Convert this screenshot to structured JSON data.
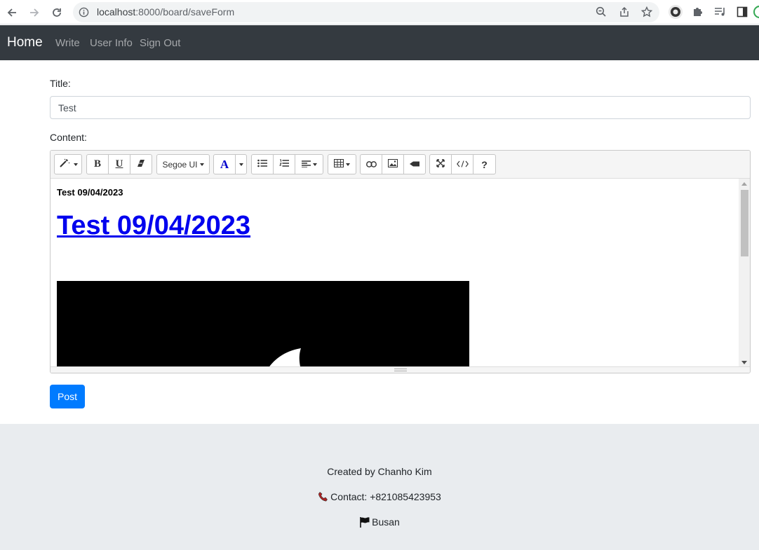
{
  "browser": {
    "url_host": "localhost",
    "url_path": ":8000/board/saveForm"
  },
  "navbar": {
    "brand": "Home",
    "links": [
      "Write",
      "User Info",
      "Sign Out"
    ]
  },
  "form": {
    "title_label": "Title:",
    "title_value": "Test",
    "content_label": "Content:",
    "post_button": "Post"
  },
  "editor": {
    "font_select": "Segoe UI",
    "toolbar_icons": [
      "magic-wand-icon",
      "bold-icon",
      "underline-icon",
      "eraser-icon",
      "font-family-dropdown",
      "font-color-icon",
      "color-caret-icon",
      "unordered-list-icon",
      "ordered-list-icon",
      "align-icon",
      "table-icon",
      "link-icon",
      "picture-icon",
      "video-icon",
      "fullscreen-icon",
      "code-view-icon",
      "help-icon"
    ],
    "content_small": "Test 09/04/2023",
    "content_heading": "Test 09/04/2023"
  },
  "footer": {
    "created_by": "Created by Chanho Kim",
    "contact": "Contact: +821085423953",
    "location": "Busan"
  },
  "colors": {
    "navbar_bg": "#343a40",
    "primary": "#007bff",
    "footer_bg": "#e9ecef",
    "link": "#0000ee"
  }
}
